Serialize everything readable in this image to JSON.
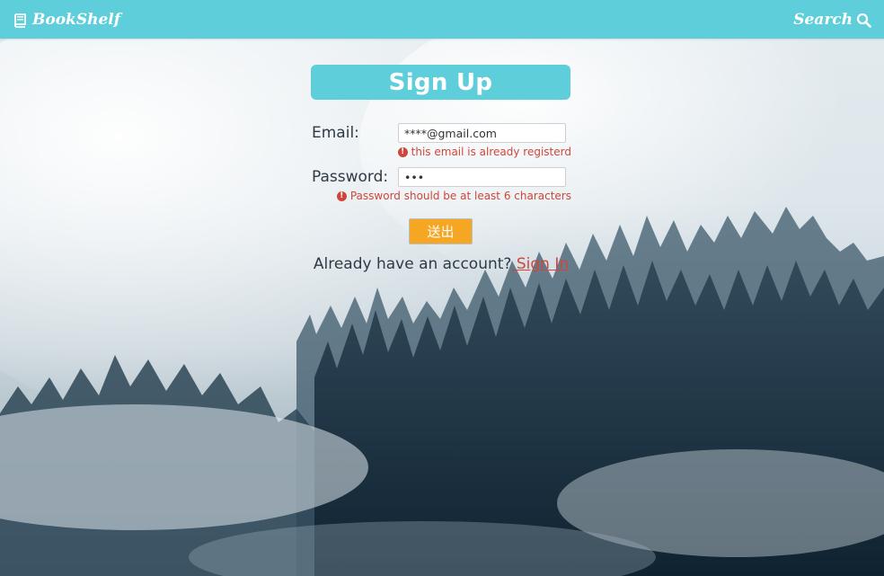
{
  "navbar": {
    "brand": "BookShelf",
    "search_label": "Search"
  },
  "form": {
    "title": "Sign Up",
    "email_label": "Email:",
    "email_value": "****@gmail.com",
    "email_error": "this email is already registerd",
    "password_label": "Password:",
    "password_value": "•••",
    "password_error": "Password should be at least 6 characters",
    "submit_label": "送出",
    "signin_prompt": "Already have an account?",
    "signin_link": " Sign In"
  },
  "colors": {
    "accent": "#5fcedb",
    "error": "#d0453a",
    "submit": "#f5a623"
  }
}
